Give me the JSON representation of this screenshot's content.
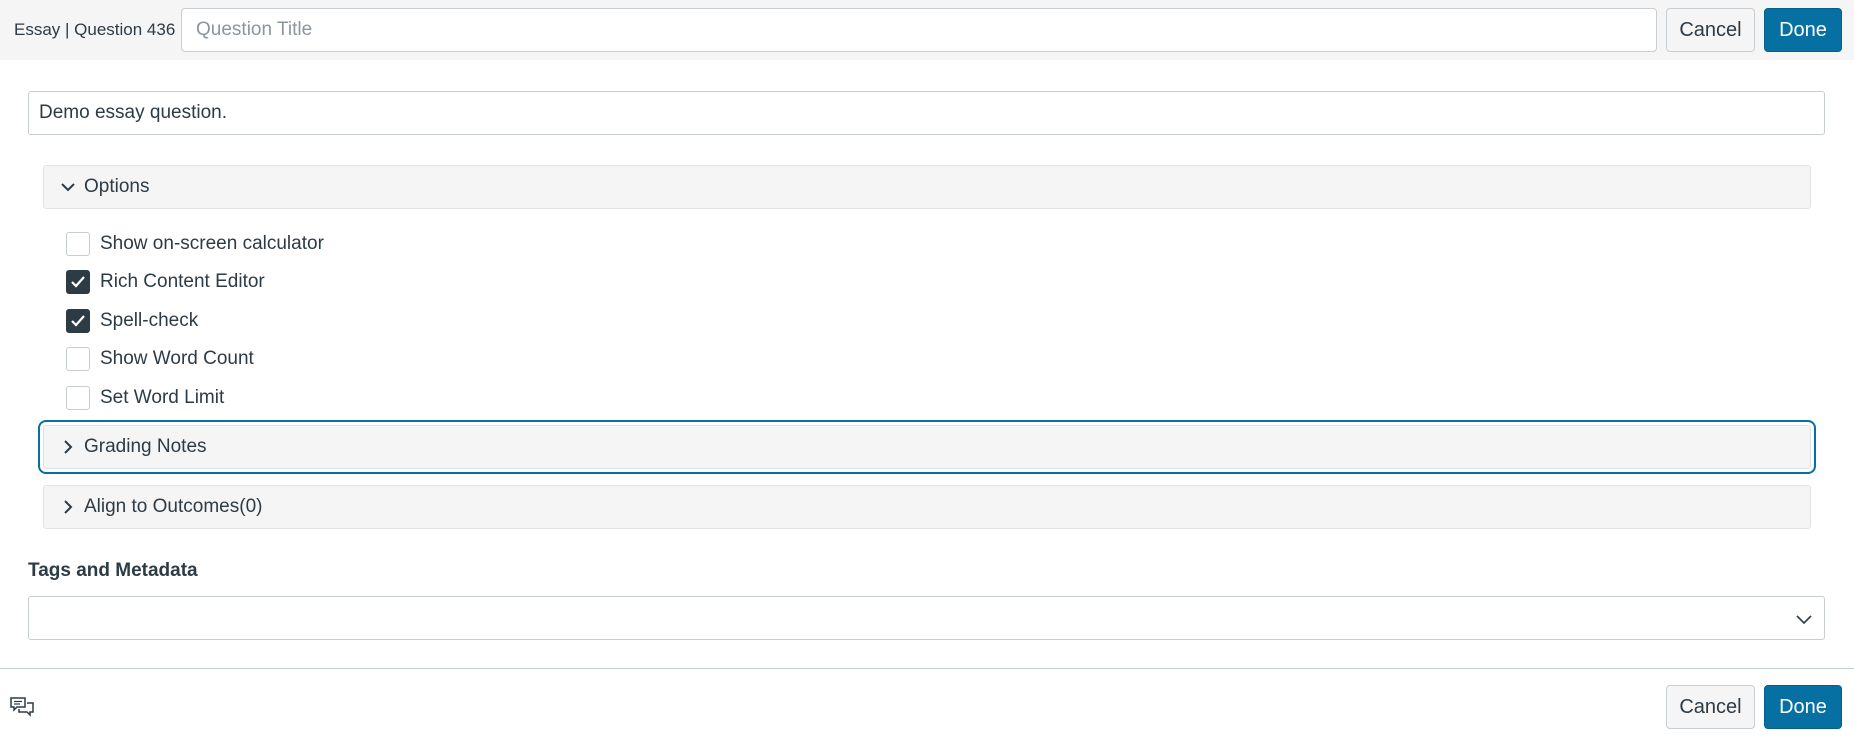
{
  "header": {
    "title": "Essay | Question 436",
    "title_placeholder": "Question Title",
    "cancel_label": "Cancel",
    "done_label": "Done"
  },
  "question": {
    "text": "Demo essay question."
  },
  "options_section": {
    "label": "Options",
    "expanded": true,
    "items": [
      {
        "label": "Show on-screen calculator",
        "checked": false
      },
      {
        "label": "Rich Content Editor",
        "checked": true
      },
      {
        "label": "Spell-check",
        "checked": true
      },
      {
        "label": "Show Word Count",
        "checked": false
      },
      {
        "label": "Set Word Limit",
        "checked": false
      }
    ]
  },
  "grading_notes": {
    "label": "Grading Notes",
    "expanded": false
  },
  "outcomes": {
    "label": "Align to Outcomes(0)",
    "expanded": false
  },
  "tags": {
    "label": "Tags and Metadata",
    "value": ""
  },
  "footer": {
    "cancel_label": "Cancel",
    "done_label": "Done"
  },
  "colors": {
    "primary": "#0770a3",
    "text": "#2d3b45",
    "checked_box": "#2d3b45"
  }
}
